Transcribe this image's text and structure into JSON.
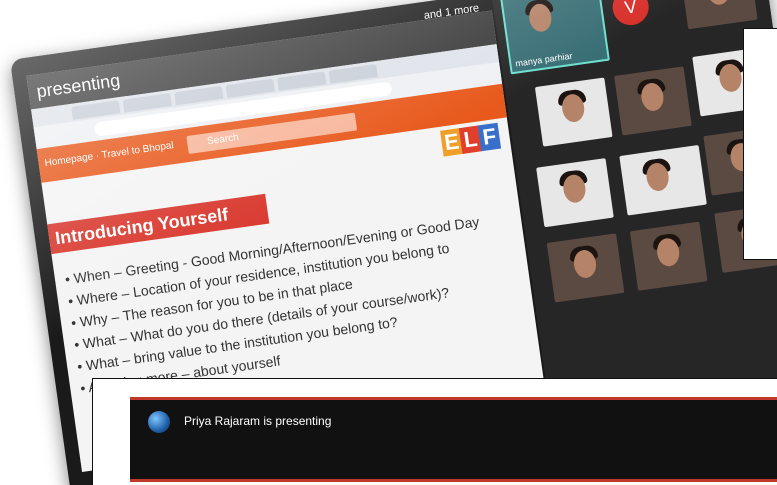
{
  "presenting_bar": {
    "label": "presenting"
  },
  "browser": {
    "url": "",
    "site_left": "Homepage · Travel to Bhopal",
    "search_placeholder": "Search"
  },
  "logo": {
    "letters": [
      "E",
      "L",
      "F"
    ],
    "colors": [
      "#f0a02a",
      "#e0402b",
      "#3a6fc9"
    ]
  },
  "slide": {
    "title": "Introducing Yourself",
    "bullets": [
      "• When – Greeting - Good Morning/Afternoon/Evening or Good Day",
      "• Where – Location of your residence, institution you belong to",
      "• Why – The reason for you to be in that place",
      "• What – What do you do there (details of your course/work)?",
      "• What – bring value to the institution you belong to?",
      "• Anything more – about yourself"
    ]
  },
  "participants": {
    "more_label": "and 1 more",
    "presenter_tile_name": "manya parhiar",
    "avatar_letter": "V"
  },
  "banner": {
    "text": "Priya Rajaram is presenting"
  }
}
